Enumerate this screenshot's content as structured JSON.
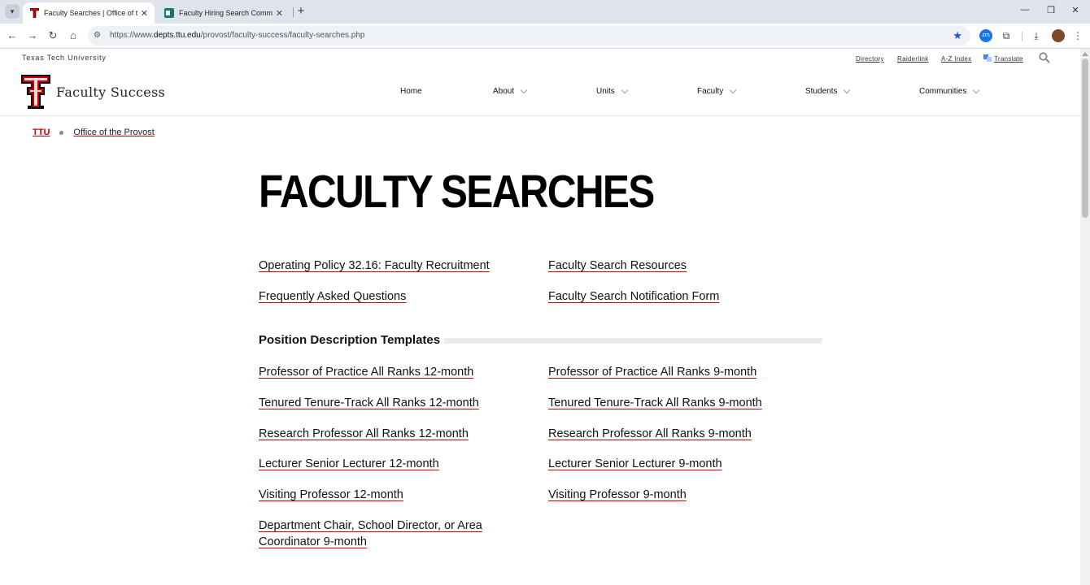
{
  "browser": {
    "tabs": [
      {
        "title": "Faculty Searches | Office of the Provost",
        "active": true
      },
      {
        "title": "Faculty Hiring Search Committee",
        "active": false
      }
    ],
    "url_prefix": "https://www.",
    "url_host": "depts.ttu.edu",
    "url_path": "/provost/faculty-success/faculty-searches.php",
    "extension_badge": "zm"
  },
  "header": {
    "university": "Texas Tech University",
    "utility_links": [
      "Directory",
      "Raiderlink",
      "A-Z Index",
      "Translate"
    ],
    "site_title": "Faculty Success",
    "nav": [
      "Home",
      "About",
      "Units",
      "Faculty",
      "Students",
      "Communities"
    ]
  },
  "breadcrumb": {
    "home": "TTU",
    "current": "Office of the Provost"
  },
  "main": {
    "title": "FACULTY SEARCHES",
    "top_links": [
      "Operating Policy 32.16: Faculty Recruitment",
      "Faculty Search Resources",
      "Frequently Asked Questions",
      "Faculty Search Notification Form"
    ],
    "section_heading": "Position Description Templates",
    "templates_left": [
      "Professor of Practice All Ranks 12-month",
      "Tenured Tenure-Track All Ranks 12-month",
      "Research Professor All Ranks 12-month",
      "Lecturer Senior Lecturer 12-month",
      "Visiting Professor 12-month",
      "Department Chair, School Director, or Area Coordinator 9-month"
    ],
    "templates_right": [
      "Professor of Practice All Ranks 9-month",
      "Tenured Tenure-Track All Ranks 9-month",
      "Research Professor All Ranks 9-month",
      "Lecturer Senior Lecturer 9-month",
      "Visiting Professor 9-month"
    ]
  },
  "colors": {
    "brand_red": "#cc0000",
    "link_underline": "#cc0000",
    "bookmark_star": "#1a56c8"
  },
  "icons": [
    "tab-list-icon",
    "close-icon",
    "new-tab-icon",
    "minimize-icon",
    "restore-icon",
    "back-icon",
    "forward-icon",
    "reload-icon",
    "home-icon",
    "site-info-icon",
    "star-icon",
    "extensions-icon",
    "download-icon",
    "menu-icon",
    "translate-icon",
    "search-icon",
    "chevron-down-icon"
  ]
}
